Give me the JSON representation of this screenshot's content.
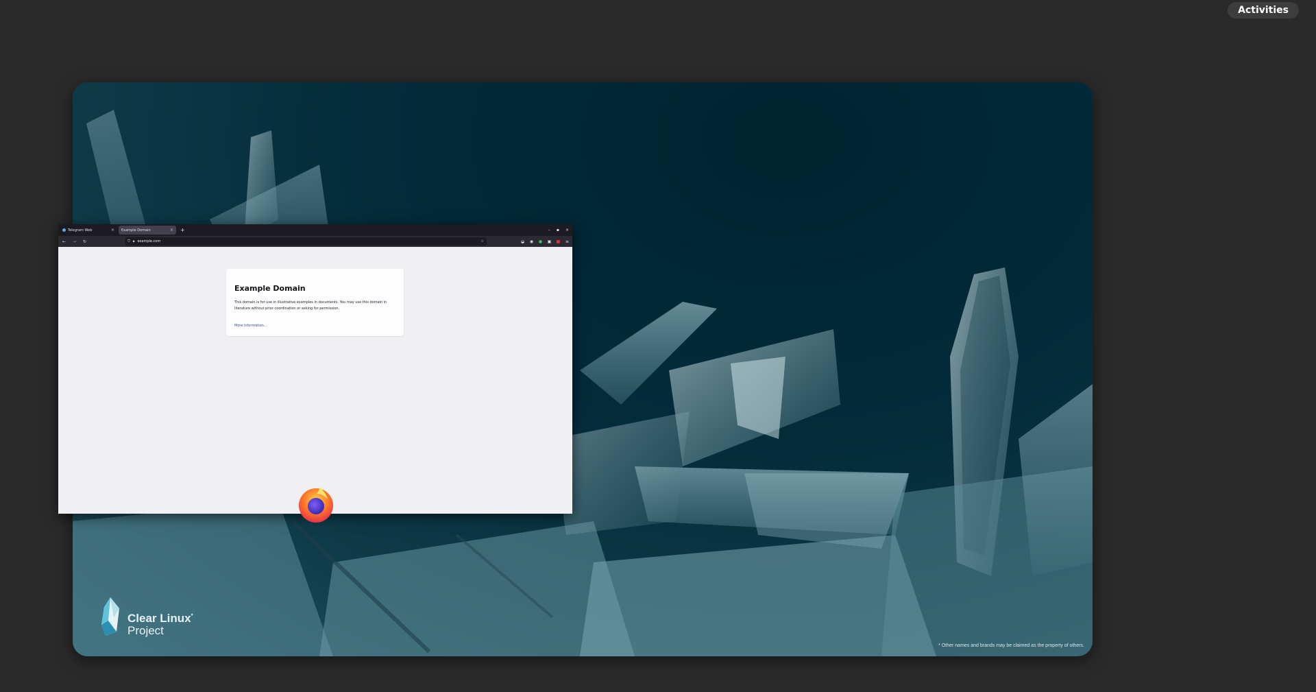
{
  "topbar": {
    "activities_label": "Activities"
  },
  "workspace": {
    "logo": {
      "line1": "Clear Linux",
      "trademark": "*",
      "line2": "Project"
    },
    "disclaimer": "* Other names and brands may be claimed as the property of others."
  },
  "browser": {
    "tabs": [
      {
        "label": "Telegram Web",
        "icon": "telegram-icon",
        "active": false
      },
      {
        "label": "Example Domain",
        "icon": "",
        "active": true
      }
    ],
    "new_tab_label": "+",
    "window_controls": [
      "–",
      "▪",
      "×"
    ],
    "address": "example.com",
    "page": {
      "heading": "Example Domain",
      "paragraph": "This domain is for use in illustrative examples in documents. You may use this domain in literature without prior coordination or asking for permission.",
      "link": "More information..."
    }
  },
  "colors": {
    "desktop_bg": "#2a2a2a",
    "wallpaper_dark": "#00232f",
    "wallpaper_light": "#5d8e9a",
    "tabbar": "#1c1b22",
    "navbar": "#2b2a33",
    "link": "#38488f"
  },
  "dock_icon": "firefox-icon"
}
